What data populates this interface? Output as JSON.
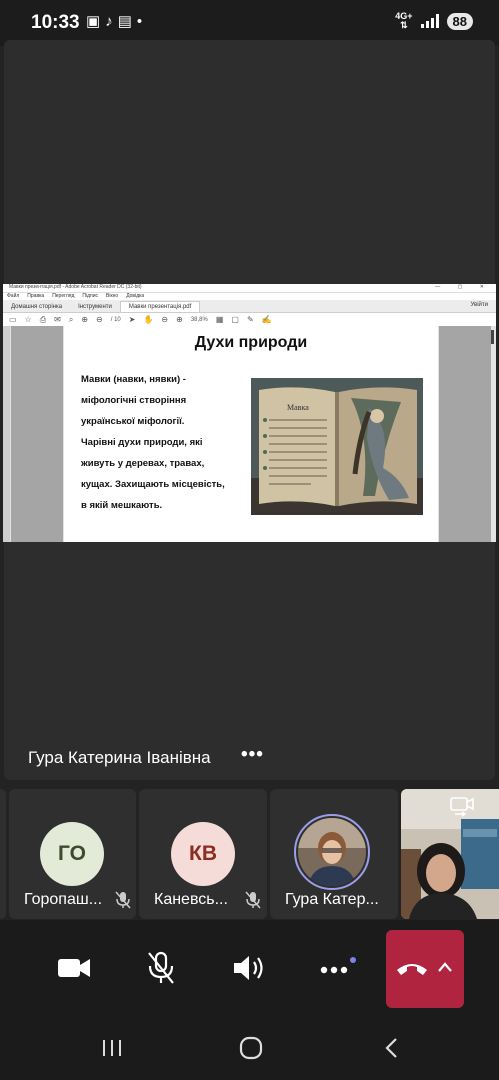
{
  "status_bar": {
    "time": "10:33",
    "network": "4G+",
    "battery": "88"
  },
  "shared_screen": {
    "app_title": "Мавки презентація.pdf - Adobe Acrobat Reader DC (32-bit)",
    "menu": [
      "Файл",
      "Правка",
      "Перегляд",
      "Підпис",
      "Вікно",
      "Довідка"
    ],
    "tabs": [
      "Домашня сторінка",
      "Інструменти",
      "Мавки презентація.pdf"
    ],
    "sign_in": "Увійти",
    "zoom": "38,8%",
    "page_indicator": "/ 10",
    "slide": {
      "title": "Духи природи",
      "body": "Мавки (навки, нявки) -\nміфологічні створіння\nукраїнської міфології.\nЧарівні духи природи, які\nживуть у деревах, травах,\nкущах. Захищають місцевість,\nв якій мешкають.",
      "book_page_heading": "Мавка"
    }
  },
  "presenter": {
    "name": "Гура Катерина Іванівна",
    "more_label": "•••"
  },
  "participants": [
    {
      "initials": "ГО",
      "name": "Горопаш...",
      "avatar_bg": "#e3ead8",
      "avatar_fg": "#3d4a2d"
    },
    {
      "initials": "КВ",
      "name": "Каневсь...",
      "avatar_bg": "#f6dcd8",
      "avatar_fg": "#8a2e22"
    },
    {
      "initials": "",
      "name": "Гура Катер..."
    }
  ],
  "icons": {
    "camera": "video-camera-icon",
    "mic": "mic-off-icon",
    "speaker": "speaker-icon",
    "more": "more-icon",
    "hangup": "hang-up-icon",
    "expand": "chevron-up-icon",
    "switch_camera": "switch-camera-icon"
  },
  "colors": {
    "hangup": "#b12440",
    "notification_dot": "#7b83eb",
    "speaker_ring": "#9aa0e8"
  }
}
